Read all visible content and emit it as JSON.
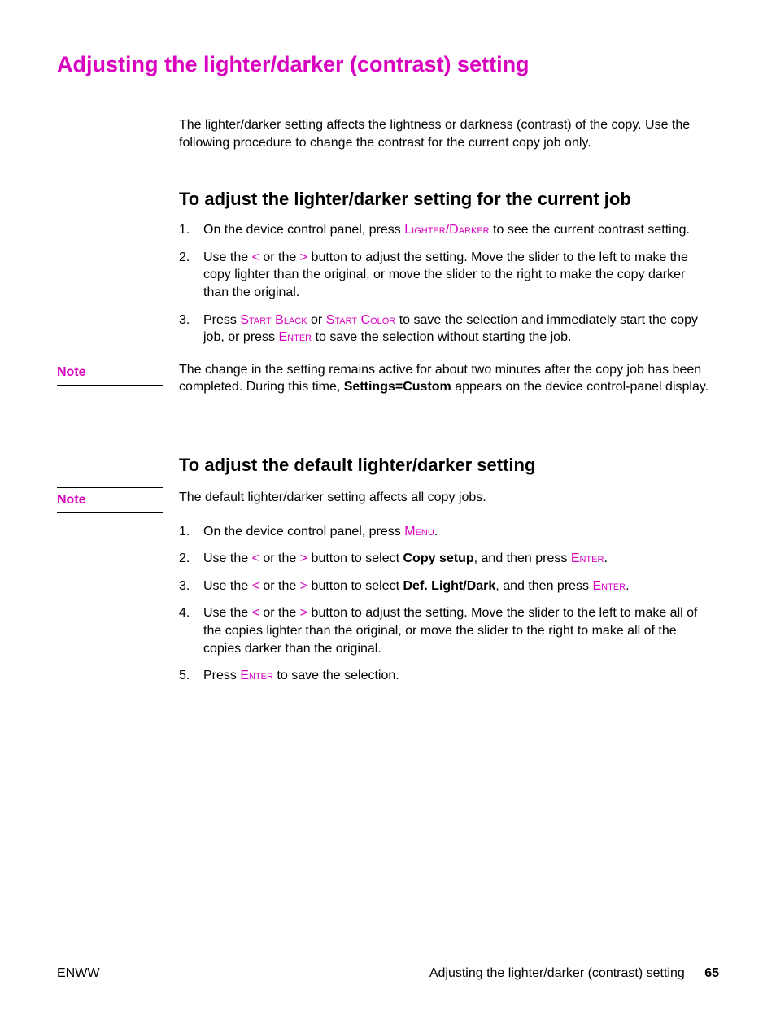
{
  "title": "Adjusting the lighter/darker (contrast) setting",
  "intro": "The lighter/darker setting affects the lightness or darkness (contrast) of the copy. Use the following procedure to change the contrast for the current copy job only.",
  "section1": {
    "heading": "To adjust the lighter/darker setting for the current job",
    "steps": [
      {
        "num": "1.",
        "pre": "On the device control panel, press ",
        "btn1": "Lighter/Darker",
        "post": " to see the current contrast setting."
      },
      {
        "num": "2.",
        "pre": "Use the ",
        "lt": "<",
        "mid1": " or the ",
        "gt": ">",
        "post": " button to adjust the setting. Move the slider to the left to make the copy lighter than the original, or move the slider to the right to make the copy darker than the original."
      },
      {
        "num": "3.",
        "pre": "Press ",
        "btn1": "Start Black",
        "mid1": " or ",
        "btn2": "Start Color",
        "mid2": " to save the selection and immediately start the copy job, or press ",
        "btn3": "Enter",
        "post": " to save the selection without starting the job."
      }
    ]
  },
  "note1": {
    "label": "Note",
    "text_pre": "The change in the setting remains active for about two minutes after the copy job has been completed. During this time, ",
    "bold": "Settings=Custom",
    "text_post": " appears on the device control-panel display."
  },
  "section2": {
    "heading": "To adjust the default lighter/darker setting"
  },
  "note2": {
    "label": "Note",
    "text": "The default lighter/darker setting affects all copy jobs."
  },
  "section2_steps": [
    {
      "num": "1.",
      "pre": "On the device control panel, press ",
      "btn1": "Menu",
      "post": "."
    },
    {
      "num": "2.",
      "pre": "Use the ",
      "lt": "<",
      "mid1": " or the ",
      "gt": ">",
      "mid2": " button to select ",
      "bold": "Copy setup",
      "mid3": ", and then press ",
      "btn1": "Enter",
      "post": "."
    },
    {
      "num": "3.",
      "pre": "Use the ",
      "lt": "<",
      "mid1": " or the ",
      "gt": ">",
      "mid2": " button to select ",
      "bold": "Def. Light/Dark",
      "mid3": ", and then press ",
      "btn1": "Enter",
      "post": "."
    },
    {
      "num": "4.",
      "pre": "Use the ",
      "lt": "<",
      "mid1": " or the ",
      "gt": ">",
      "post": " button to adjust the setting. Move the slider to the left to make all of the copies lighter than the original, or move the slider to the right to make all of the copies darker than the original."
    },
    {
      "num": "5.",
      "pre": "Press ",
      "btn1": "Enter",
      "post": " to save the selection."
    }
  ],
  "footer": {
    "left": "ENWW",
    "right": "Adjusting the lighter/darker (contrast) setting",
    "page": "65"
  }
}
